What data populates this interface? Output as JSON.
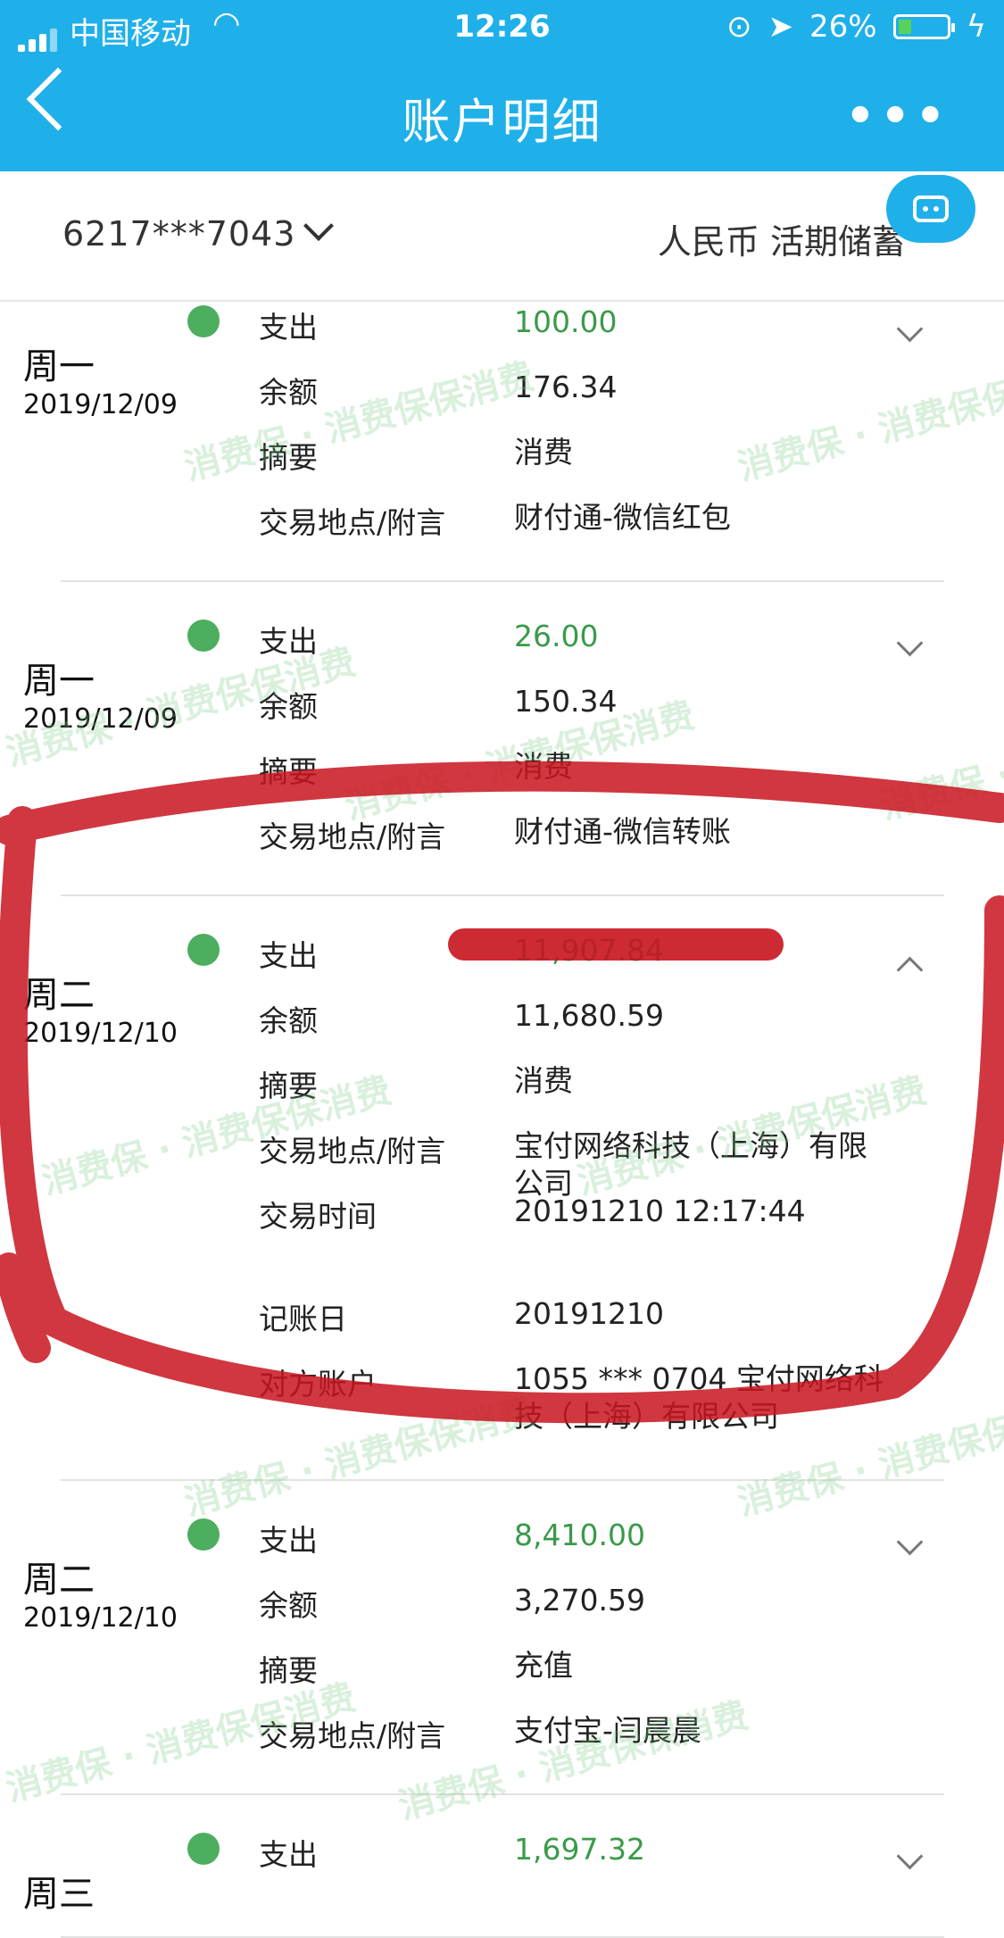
{
  "status_bar": {
    "carrier": "中国移动",
    "time": "12:26",
    "battery": "26%"
  },
  "nav": {
    "title": "账户明细"
  },
  "account": {
    "number": "6217***7043",
    "currency_type": "人民币 活期储蓄"
  },
  "watermark": "消费保 · 消费保保消费",
  "transactions": [
    {
      "day": "周一",
      "date": "2019/12/09",
      "expanded": false,
      "rows": [
        {
          "label": "支出",
          "value": "100.00"
        },
        {
          "label": "余额",
          "value": "176.34"
        },
        {
          "label": "摘要",
          "value": "消费"
        },
        {
          "label": "交易地点/附言",
          "value": "财付通-微信红包"
        }
      ]
    },
    {
      "day": "周一",
      "date": "2019/12/09",
      "expanded": false,
      "rows": [
        {
          "label": "支出",
          "value": "26.00"
        },
        {
          "label": "余额",
          "value": "150.34"
        },
        {
          "label": "摘要",
          "value": "消费"
        },
        {
          "label": "交易地点/附言",
          "value": "财付通-微信转账"
        }
      ]
    },
    {
      "day": "周二",
      "date": "2019/12/10",
      "expanded": true,
      "rows": [
        {
          "label": "支出",
          "value": "11,907.84"
        },
        {
          "label": "余额",
          "value": "11,680.59"
        },
        {
          "label": "摘要",
          "value": "消费"
        },
        {
          "label": "交易地点/附言",
          "value": "宝付网络科技（上海）有限公司"
        },
        {
          "label": "交易时间",
          "value": "20191210 12:17:44"
        },
        {
          "label": "记账日",
          "value": "20191210"
        },
        {
          "label": "对方账户",
          "value": "1055 *** 0704 宝付网络科技（上海）有限公司"
        }
      ]
    },
    {
      "day": "周二",
      "date": "2019/12/10",
      "expanded": false,
      "rows": [
        {
          "label": "支出",
          "value": "8,410.00"
        },
        {
          "label": "余额",
          "value": "3,270.59"
        },
        {
          "label": "摘要",
          "value": "充值"
        },
        {
          "label": "交易地点/附言",
          "value": "支付宝-闫晨晨"
        }
      ]
    },
    {
      "day": "周三",
      "date": "",
      "expanded": false,
      "rows": [
        {
          "label": "支出",
          "value": "1,697.32"
        }
      ]
    }
  ]
}
